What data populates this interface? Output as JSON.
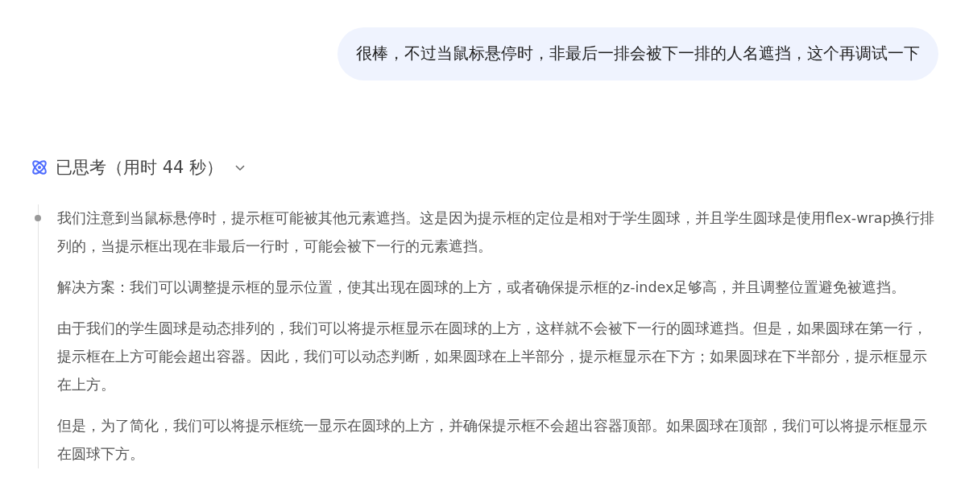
{
  "user_message": "很棒，不过当鼠标悬停时，非最后一排会被下一排的人名遮挡，这个再调试一下",
  "thinking": {
    "label": "已思考（用时 44 秒）",
    "expanded": true,
    "paragraphs": [
      "我们注意到当鼠标悬停时，提示框可能被其他元素遮挡。这是因为提示框的定位是相对于学生圆球，并且学生圆球是使用flex-wrap换行排列的，当提示框出现在非最后一行时，可能会被下一行的元素遮挡。",
      "解决方案：我们可以调整提示框的显示位置，使其出现在圆球的上方，或者确保提示框的z-index足够高，并且调整位置避免被遮挡。",
      "由于我们的学生圆球是动态排列的，我们可以将提示框显示在圆球的上方，这样就不会被下一行的圆球遮挡。但是，如果圆球在第一行，提示框在上方可能会超出容器。因此，我们可以动态判断，如果圆球在上半部分，提示框显示在下方；如果圆球在下半部分，提示框显示在上方。",
      "但是，为了简化，我们可以将提示框统一显示在圆球的上方，并确保提示框不会超出容器顶部。如果圆球在顶部，我们可以将提示框显示在圆球下方。"
    ]
  }
}
